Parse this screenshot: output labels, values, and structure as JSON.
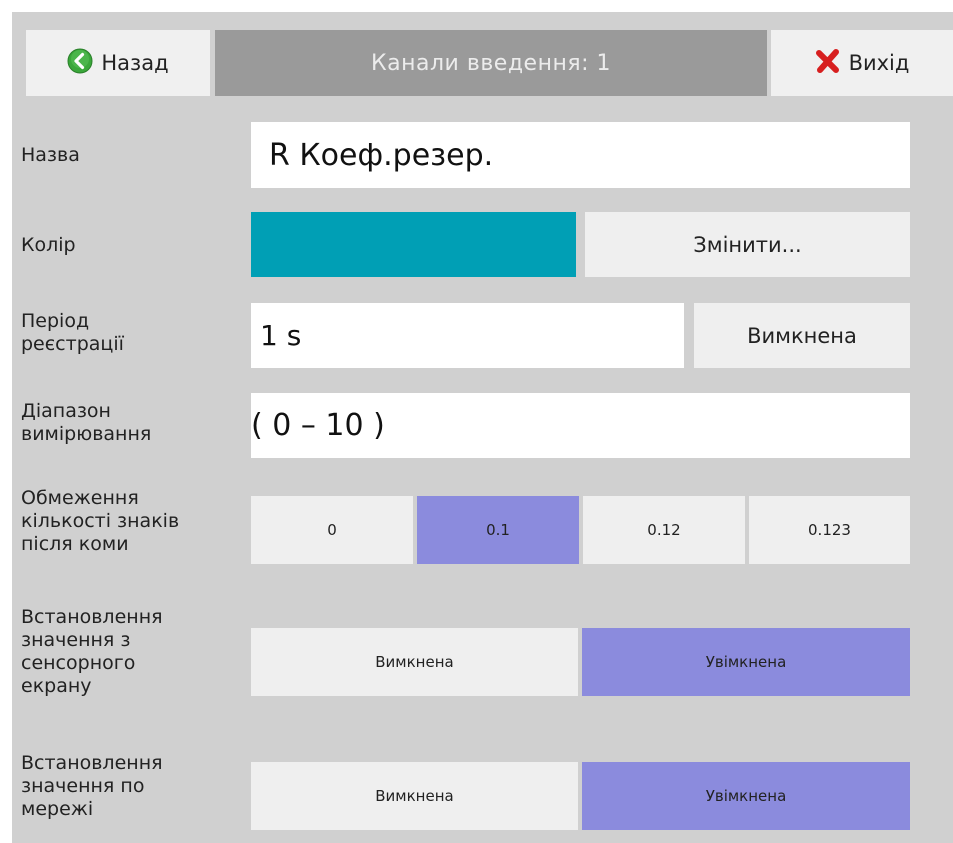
{
  "header": {
    "back_label": "Назад",
    "title": "Канали введення: 1",
    "exit_label": "Вихід"
  },
  "colors": {
    "channel_color": "#009fb5",
    "selected_segment": "#8b8bdd",
    "panel_bg": "#d0d0d0"
  },
  "name": {
    "label": "Назва",
    "value": "R Коеф.резер."
  },
  "color": {
    "label": "Колір",
    "change_button": "Змінити..."
  },
  "period": {
    "label_line1": "Період",
    "label_line2": "реєстрації",
    "value": "1 s",
    "toggle_button": "Вимкнена"
  },
  "range": {
    "label_line1": "Діапазон",
    "label_line2": "вимірювання",
    "value": "( 0 – 10 )"
  },
  "decimals": {
    "label_line1": "Обмеження",
    "label_line2": "кількості знаків",
    "label_line3": "після коми",
    "options": [
      "0",
      "0.1",
      "0.12",
      "0.123"
    ],
    "selected": "0.1"
  },
  "touch_set": {
    "label_line1": "Встановлення",
    "label_line2": "значення з",
    "label_line3": "сенсорного",
    "label_line4": "екрану",
    "off_label": "Вимкнена",
    "on_label": "Увімкнена",
    "selected": "Увімкнена"
  },
  "network_set": {
    "label_line1": "Встановлення",
    "label_line2": "значення по",
    "label_line3": "мережі",
    "off_label": "Вимкнена",
    "on_label": "Увімкнена",
    "selected": "Увімкнена"
  }
}
